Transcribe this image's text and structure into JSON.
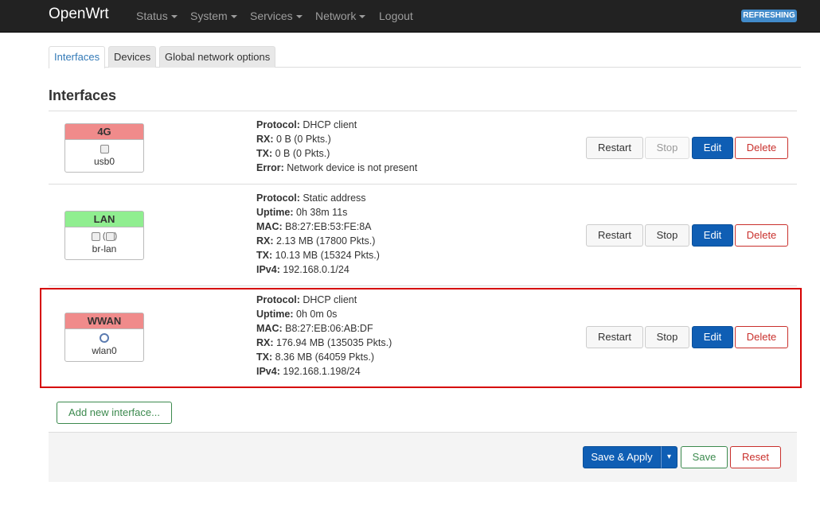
{
  "navbar": {
    "brand": "OpenWrt",
    "menus": [
      "Status",
      "System",
      "Services",
      "Network"
    ],
    "logout": "Logout",
    "badge": "REFRESHING"
  },
  "tabs": [
    "Interfaces",
    "Devices",
    "Global network options"
  ],
  "section_title": "Interfaces",
  "labels": {
    "protocol": "Protocol:",
    "uptime": "Uptime:",
    "mac": "MAC:",
    "rx": "RX:",
    "tx": "TX:",
    "error": "Error:",
    "ipv4": "IPv4:"
  },
  "interfaces": [
    {
      "name": "4G",
      "device": "usb0",
      "header_color": "#f08b8b",
      "protocol": "DHCP client",
      "rx": "0 B (0 Pkts.)",
      "tx": "0 B (0 Pkts.)",
      "error": "Network device is not present"
    },
    {
      "name": "LAN",
      "device": "br-lan",
      "header_color": "#90ee90",
      "protocol": "Static address",
      "uptime": "0h 38m 11s",
      "mac": "B8:27:EB:53:FE:8A",
      "rx": "2.13 MB (17800 Pkts.)",
      "tx": "10.13 MB (15324 Pkts.)",
      "ipv4": "192.168.0.1/24"
    },
    {
      "name": "WWAN",
      "device": "wlan0",
      "header_color": "#f08b8b",
      "protocol": "DHCP client",
      "uptime": "0h 0m 0s",
      "mac": "B8:27:EB:06:AB:DF",
      "rx": "176.94 MB (135035 Pkts.)",
      "tx": "8.36 MB (64059 Pkts.)",
      "ipv4": "192.168.1.198/24"
    }
  ],
  "row_buttons": {
    "restart": "Restart",
    "stop": "Stop",
    "edit": "Edit",
    "delete": "Delete"
  },
  "add_interface": "Add new interface...",
  "footer": {
    "save_apply": "Save & Apply",
    "dropdown": "▾",
    "save": "Save",
    "reset": "Reset"
  }
}
